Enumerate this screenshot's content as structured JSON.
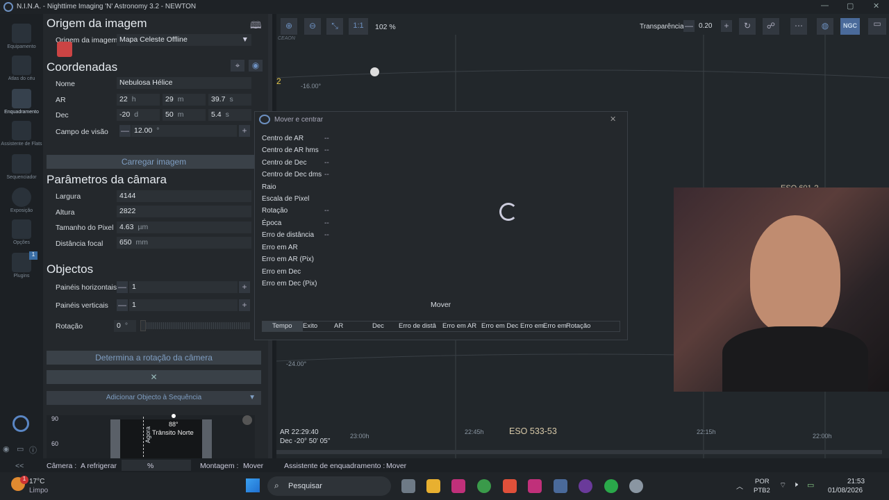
{
  "titlebar": {
    "title": "N.I.N.A. - Nighttime Imaging 'N' Astronomy 3.2   -   NEWTON"
  },
  "sidebar": {
    "items": [
      {
        "label": "Equipamento"
      },
      {
        "label": "Atlas do céu"
      },
      {
        "label": "Enquadramento"
      },
      {
        "label": "Assistente de Flats"
      },
      {
        "label": "Sequenciador"
      },
      {
        "label": "Exposição"
      },
      {
        "label": "Opções"
      },
      {
        "label": "Plugins"
      }
    ],
    "plugins_badge": "1"
  },
  "left": {
    "source_title": "Origem da imagem",
    "source_label": "Origem da imagem",
    "source_value": "Mapa Celeste Offline",
    "coords_title": "Coordenadas",
    "name_label": "Nome",
    "name_value": "Nebulosa Hélice",
    "ra_label": "AR",
    "ra_h": "22",
    "ra_h_u": "h",
    "ra_m": "29",
    "ra_m_u": "m",
    "ra_s": "39.7",
    "ra_s_u": "s",
    "dec_label": "Dec",
    "dec_d": "-20",
    "dec_d_u": "d",
    "dec_m": "50",
    "dec_m_u": "m",
    "dec_s": "5.4",
    "dec_s_u": "s",
    "fov_label": "Campo de visão",
    "fov_value": "12.00",
    "fov_unit": "°",
    "load_button": "Carregar imagem",
    "cam_title": "Parâmetros da câmara",
    "width_label": "Largura",
    "width_value": "4144",
    "height_label": "Altura",
    "height_value": "2822",
    "pixel_label": "Tamanho do Pixel",
    "pixel_value": "4.63",
    "pixel_unit": "µm",
    "focal_label": "Distância focal",
    "focal_value": "650",
    "focal_unit": "mm",
    "obj_title": "Objectos",
    "hpanels_label": "Painéis horizontais",
    "hpanels_value": "1",
    "vpanels_label": "Painéis verticais",
    "vpanels_value": "1",
    "rot_label": "Rotação",
    "rot_value": "0",
    "rot_unit": "°",
    "determine_button": "Determina a rotação da câmera",
    "add_button": "Adicionar Objecto à Sequência",
    "alt_90": "90",
    "alt_60": "60",
    "now_label": "Agora",
    "transit_deg": "88°",
    "transit_label": "Trânsito Norte"
  },
  "toolbar": {
    "zoom": "102 %",
    "one_one": "1:1",
    "transp_label": "Transparência",
    "transp_value": "0.20",
    "ngc": "NGC"
  },
  "sky": {
    "deg1": "-16.00°",
    "deg2": "-24.00°",
    "num2": "2",
    "eso_top": "ESO 601-?",
    "ra_readout": "AR  22:29:40",
    "dec_readout": "Dec  -20° 50' 05\"",
    "ra_ticks": [
      "23:00h",
      "22:45h",
      "22:15h",
      "22:00h"
    ],
    "eso_bottom": "ESO 533-53",
    "top_label": "CEAON"
  },
  "dialog": {
    "title": "Mover e centrar",
    "rows": [
      {
        "label": "Centro de AR",
        "value": "--"
      },
      {
        "label": "Centro de AR hms",
        "value": "--"
      },
      {
        "label": "Centro de Dec",
        "value": "--"
      },
      {
        "label": "Centro de Dec dms",
        "value": "--"
      },
      {
        "label": "Raio",
        "value": ""
      },
      {
        "label": "Escala de Pixel",
        "value": ""
      },
      {
        "label": "Rotação",
        "value": "--"
      },
      {
        "label": "Época",
        "value": "--"
      },
      {
        "label": "Erro de distância",
        "value": "--"
      },
      {
        "label": "Erro em AR",
        "value": ""
      },
      {
        "label": "Erro em AR (Pix)",
        "value": ""
      },
      {
        "label": "Erro em Dec",
        "value": ""
      },
      {
        "label": "Erro em Dec (Pix)",
        "value": ""
      }
    ],
    "move_label": "Mover",
    "columns": [
      "Tempo",
      "Exito",
      "AR",
      "Dec",
      "Erro de distâ",
      "Erro em AR",
      "Erro em Dec",
      "Erro em",
      "Erro em",
      "Rotação"
    ]
  },
  "status": {
    "camera_label": "Câmera :",
    "camera_value": "A refrigerar",
    "percent": "%",
    "mount_label": "Montagem :",
    "mount_value": "Mover",
    "framing_label": "Assistente de enquadramento :",
    "framing_value": "Mover",
    "collapse": "<<"
  },
  "taskbar": {
    "temp": "17°C",
    "weather": "Limpo",
    "weather_badge": "1",
    "search": "Pesquisar",
    "lang1": "POR",
    "lang2": "PTB2",
    "time": "21:53",
    "date": "01/08/2026"
  },
  "colors": {
    "accent": "#6d90c0",
    "panel": "#24282c",
    "bg": "#1a1e22"
  }
}
